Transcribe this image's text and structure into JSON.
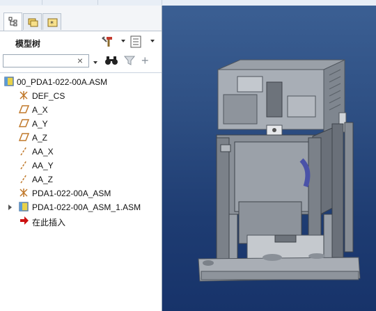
{
  "window": {
    "model_tree_title": "模型树"
  },
  "tabs": [
    {
      "name": "model-tree-tab",
      "icon": "tree-icon",
      "active": true
    },
    {
      "name": "folder-browser-tab",
      "icon": "folders-icon",
      "active": false
    },
    {
      "name": "favorites-tab",
      "icon": "favorites-icon",
      "active": false
    }
  ],
  "toolbar": {
    "settings_icon": "tools-icon",
    "show_icon": "list-icon",
    "find_icon": "binoculars-icon",
    "filter_icon": "filter-icon",
    "add_icon": "plus-icon",
    "clear_symbol": "×",
    "add_symbol": "+"
  },
  "search": {
    "value": "",
    "placeholder": ""
  },
  "tree": [
    {
      "label": "00_PDA1-022-00A.ASM",
      "icon": "assembly-icon",
      "indent": 0,
      "expandable": false
    },
    {
      "label": "DEF_CS",
      "icon": "coordinate-system-icon",
      "indent": 1,
      "expandable": false
    },
    {
      "label": "A_X",
      "icon": "datum-plane-icon",
      "indent": 1,
      "expandable": false
    },
    {
      "label": "A_Y",
      "icon": "datum-plane-icon",
      "indent": 1,
      "expandable": false
    },
    {
      "label": "A_Z",
      "icon": "datum-plane-icon",
      "indent": 1,
      "expandable": false
    },
    {
      "label": "AA_X",
      "icon": "datum-axis-icon",
      "indent": 1,
      "expandable": false
    },
    {
      "label": "AA_Y",
      "icon": "datum-axis-icon",
      "indent": 1,
      "expandable": false
    },
    {
      "label": "AA_Z",
      "icon": "datum-axis-icon",
      "indent": 1,
      "expandable": false
    },
    {
      "label": "PDA1-022-00A_ASM",
      "icon": "coordinate-system-icon",
      "indent": 1,
      "expandable": false
    },
    {
      "label": "PDA1-022-00A_ASM_1.ASM",
      "icon": "assembly-icon",
      "indent": 1,
      "expandable": true
    },
    {
      "label": "在此插入",
      "icon": "insert-here-arrow-icon",
      "indent": 1,
      "expandable": false
    }
  ],
  "colors": {
    "viewport_top": "#3b5f93",
    "viewport_bottom": "#17336a",
    "insert_arrow": "#cc1111",
    "datum_orange": "#c0782a",
    "assembly_yellow": "#e8d24a"
  }
}
